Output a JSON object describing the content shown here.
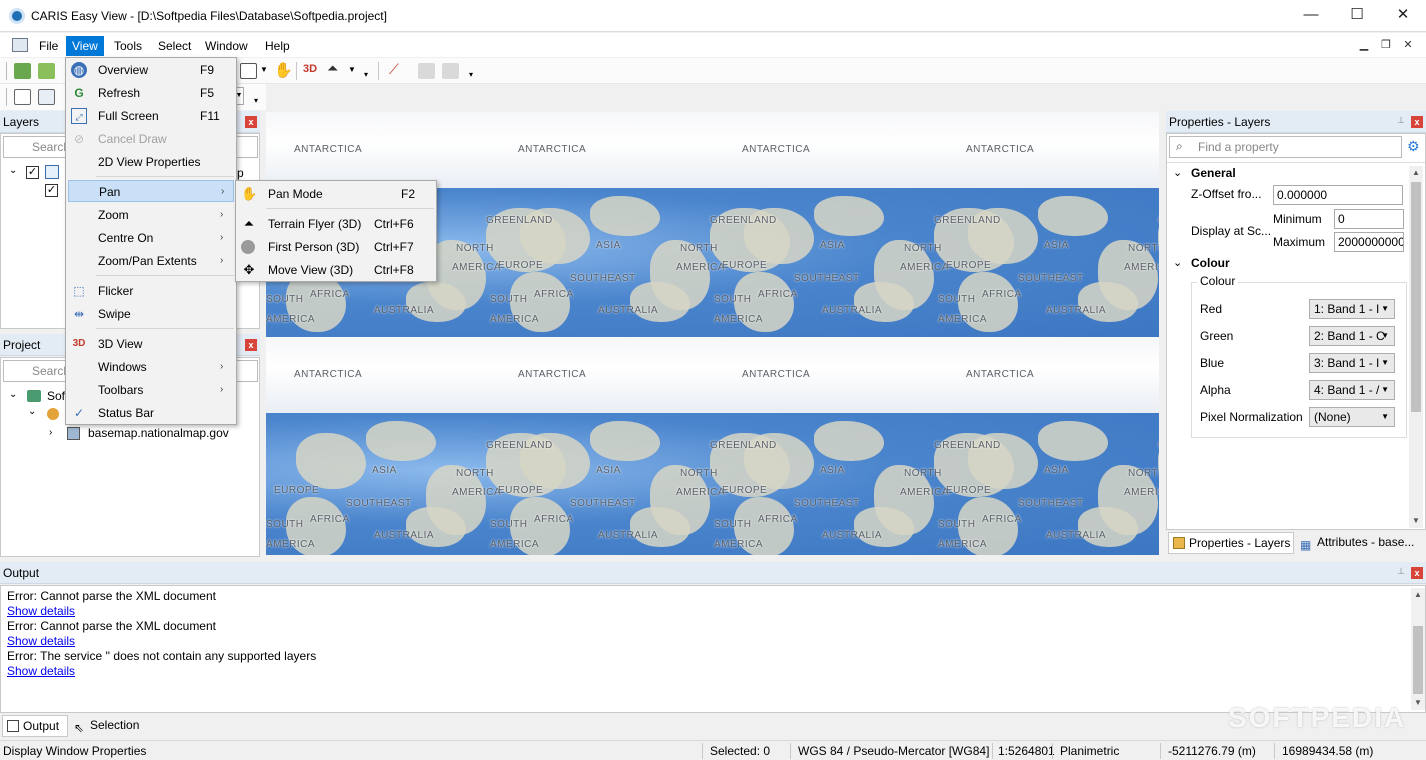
{
  "window": {
    "title": "CARIS Easy View - [D:\\Softpedia Files\\Database\\Softpedia.project]",
    "minimize": "—",
    "maximize": "☐",
    "close": "✕"
  },
  "menubar": {
    "items": [
      "File",
      "View",
      "Tools",
      "Select",
      "Window",
      "Help"
    ],
    "active": "View"
  },
  "view_menu": {
    "items": [
      {
        "label": "Overview",
        "shortcut": "F9",
        "icon": "overview-icon"
      },
      {
        "label": "Refresh",
        "shortcut": "F5",
        "icon": "refresh-icon"
      },
      {
        "label": "Full Screen",
        "shortcut": "F11",
        "icon": "fullscreen-icon"
      },
      {
        "label": "Cancel Draw",
        "shortcut": "",
        "icon": "cancel-draw-icon",
        "disabled": true
      },
      {
        "label": "2D View Properties",
        "shortcut": "",
        "icon": ""
      },
      {
        "label": "Pan",
        "submenu": true
      },
      {
        "label": "Zoom",
        "submenu": true
      },
      {
        "label": "Centre On",
        "submenu": true
      },
      {
        "label": "Zoom/Pan Extents",
        "submenu": true
      },
      {
        "label": "Flicker",
        "icon": "flicker-icon"
      },
      {
        "label": "Swipe",
        "icon": "swipe-icon"
      },
      {
        "label": "3D View",
        "icon": "3d-icon"
      },
      {
        "label": "Windows",
        "submenu": true
      },
      {
        "label": "Toolbars",
        "submenu": true
      },
      {
        "label": "Status Bar",
        "checked": true
      }
    ]
  },
  "pan_submenu": {
    "items": [
      {
        "label": "Pan Mode",
        "shortcut": "F2"
      },
      {
        "label": "Terrain Flyer (3D)",
        "shortcut": "Ctrl+F6"
      },
      {
        "label": "First Person (3D)",
        "shortcut": "Ctrl+F7"
      },
      {
        "label": "Move View (3D)",
        "shortcut": "Ctrl+F8"
      }
    ]
  },
  "layers_panel": {
    "title": "Layers",
    "search_placeholder": "Search",
    "item_suffix": "p"
  },
  "project_panel": {
    "title": "Project",
    "search_placeholder": "Search",
    "root": "Sof",
    "child": "basemap.nationalmap.gov"
  },
  "map": {
    "labels": {
      "antarctica": "ANTARCTICA",
      "greenland": "GREENLAND",
      "north": "NORTH",
      "america": "AMERICA",
      "europe": "EUROPE",
      "asia": "ASIA",
      "southeast": "SOUTHEAST",
      "africa": "AFRICA",
      "south": "SOUTH",
      "australia": "AUSTRALIA"
    }
  },
  "properties_panel": {
    "title": "Properties - Layers",
    "search_placeholder": "Find a property",
    "general": {
      "heading": "General",
      "z_offset_label": "Z-Offset fro...",
      "z_offset_value": "0.000000",
      "display_scale_label": "Display at Sc...",
      "minimum_label": "Minimum",
      "minimum_value": "0",
      "maximum_label": "Maximum",
      "maximum_value": "2000000000"
    },
    "colour": {
      "heading": "Colour",
      "group_label": "Colour",
      "rows": [
        {
          "label": "Red",
          "value": "1: Band 1 - I"
        },
        {
          "label": "Green",
          "value": "2: Band 1 - C"
        },
        {
          "label": "Blue",
          "value": "3: Band 1 - I"
        },
        {
          "label": "Alpha",
          "value": "4: Band 1 - /"
        },
        {
          "label": "Pixel Normalization",
          "value": "(None)"
        }
      ]
    },
    "tabs": [
      "Properties - Layers",
      "Attributes - base..."
    ]
  },
  "output_panel": {
    "title": "Output",
    "lines": [
      {
        "text": "Error: Cannot parse the XML document",
        "link": false
      },
      {
        "text": "Show details",
        "link": true
      },
      {
        "text": "Error: Cannot parse the XML document",
        "link": false
      },
      {
        "text": "Show details",
        "link": true
      },
      {
        "text": "Error: The service '' does not contain any supported layers",
        "link": false
      },
      {
        "text": "Show details",
        "link": true
      }
    ],
    "tabs": [
      "Output",
      "Selection"
    ]
  },
  "statusbar": {
    "message": "Display Window Properties",
    "selected": "Selected: 0",
    "crs": "WGS 84 / Pseudo-Mercator [WG84]",
    "scale": "1:5264801",
    "mode": "Planimetric",
    "x": "-5211276.79 (m)",
    "y": "16989434.58 (m)"
  },
  "watermark": "SOFTPEDIA"
}
